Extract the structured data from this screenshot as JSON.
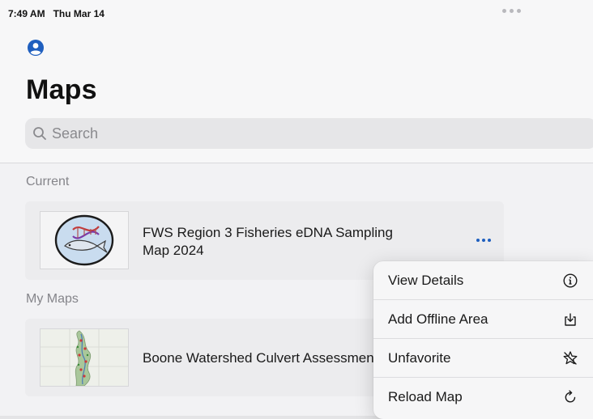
{
  "status_bar": {
    "time": "7:49 AM",
    "date": "Thu Mar 14"
  },
  "header": {
    "title": "Maps",
    "search_placeholder": "Search"
  },
  "sections": {
    "current_label": "Current",
    "my_maps_label": "My Maps"
  },
  "current_map": {
    "title_line1": "FWS Region 3 Fisheries eDNA Sampling",
    "title_line2": "Map 2024"
  },
  "my_maps": [
    {
      "title": "Boone Watershed Culvert Assessment"
    }
  ],
  "context_menu": {
    "items": [
      {
        "label": "View Details",
        "icon": "info-circle-icon"
      },
      {
        "label": "Add Offline Area",
        "icon": "download-tray-icon"
      },
      {
        "label": "Unfavorite",
        "icon": "star-slash-icon"
      },
      {
        "label": "Reload Map",
        "icon": "reload-icon"
      }
    ]
  },
  "colors": {
    "accent": "#1f5fbf",
    "background": "#f2f2f4",
    "panel": "#f7f7f8"
  }
}
